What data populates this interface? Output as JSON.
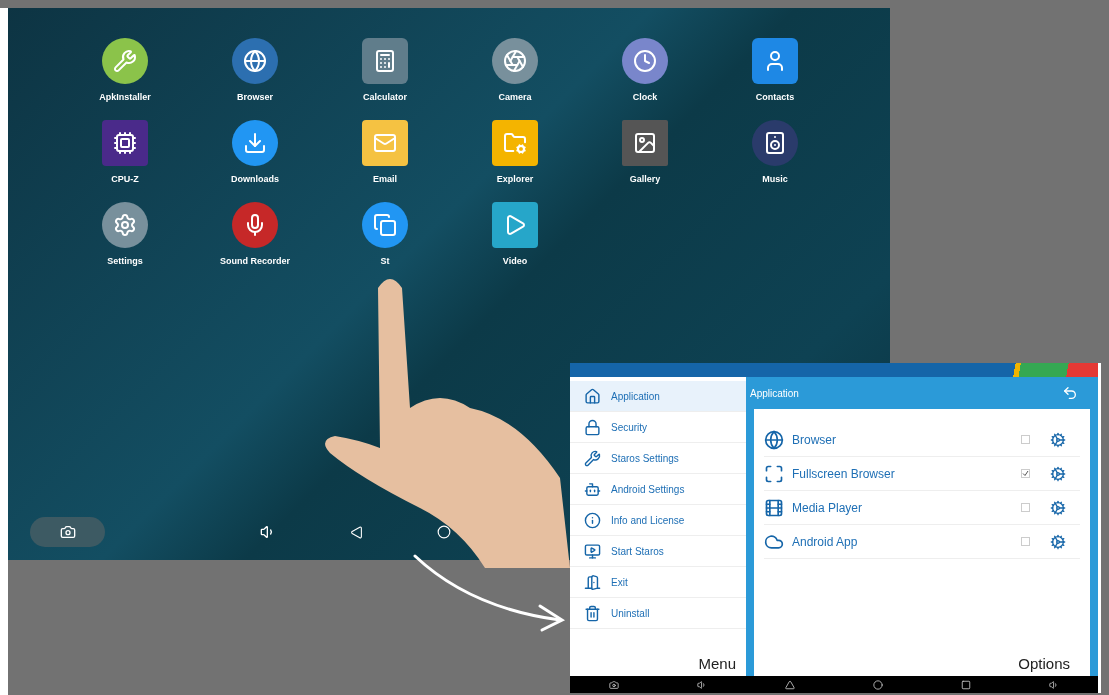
{
  "home_screen": {
    "apps": [
      {
        "label": "ApkInstaller"
      },
      {
        "label": "Browser"
      },
      {
        "label": "Calculator"
      },
      {
        "label": "Camera"
      },
      {
        "label": "Clock"
      },
      {
        "label": "Contacts"
      },
      {
        "label": "CPU-Z"
      },
      {
        "label": "Downloads"
      },
      {
        "label": "Email"
      },
      {
        "label": "Explorer"
      },
      {
        "label": "Gallery"
      },
      {
        "label": "Music"
      },
      {
        "label": "Settings"
      },
      {
        "label": "Sound Recorder"
      },
      {
        "label": "St"
      },
      {
        "label": "Video"
      }
    ]
  },
  "staros": {
    "menu": {
      "items": [
        {
          "label": "Application",
          "selected": true
        },
        {
          "label": "Security",
          "selected": false
        },
        {
          "label": "Staros Settings",
          "selected": false
        },
        {
          "label": "Android Settings",
          "selected": false
        },
        {
          "label": "Info and License",
          "selected": false
        },
        {
          "label": "Start Staros",
          "selected": false
        },
        {
          "label": "Exit",
          "selected": false
        },
        {
          "label": "Uninstall",
          "selected": false
        }
      ],
      "caption": "Menu"
    },
    "panel": {
      "title": "Application",
      "items": [
        {
          "title": "Browser",
          "checked": false
        },
        {
          "title": "Fullscreen Browser",
          "checked": true
        },
        {
          "title": "Media Player",
          "checked": false
        },
        {
          "title": "Android App",
          "checked": false
        }
      ],
      "caption": "Options"
    }
  }
}
